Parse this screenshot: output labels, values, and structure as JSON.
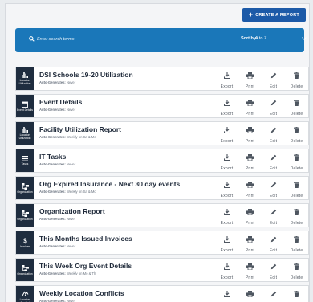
{
  "toolbar": {
    "create_label": "CREATE A REPORT"
  },
  "search": {
    "placeholder": "Enter search terms"
  },
  "sort": {
    "label": "Sort by",
    "value": "A to Z"
  },
  "actions": {
    "export": "Export",
    "print": "Print",
    "edit": "Edit",
    "delete": "Delete"
  },
  "colors": {
    "primary": "#1c5aa8",
    "search_bar": "#1a77b9",
    "type_tile": "#1f2d3f"
  },
  "reports": [
    {
      "title": "DSI Schools 19-20 Utilization",
      "auto_label": "Auto-Generates:",
      "auto_value": "Never",
      "type": "Location Utilization",
      "icon": "bar-chart-icon"
    },
    {
      "title": "Event Details",
      "auto_label": "Auto-Generates:",
      "auto_value": "Never",
      "type": "Event Details",
      "icon": "calendar-icon"
    },
    {
      "title": "Facility Utilization Report",
      "auto_label": "Auto-Generates:",
      "auto_value": "Weekly on Sa & Mo",
      "type": "Location Utilization",
      "icon": "bar-chart-icon"
    },
    {
      "title": "IT Tasks",
      "auto_label": "Auto-Generates:",
      "auto_value": "Never",
      "type": "Tasks",
      "icon": "list-icon"
    },
    {
      "title": "Org Expired Insurance - Next 30 day events",
      "auto_label": "Auto-Generates:",
      "auto_value": "Weekly on Sa & Mo",
      "type": "Organization",
      "icon": "org-chart-icon"
    },
    {
      "title": "Organization Report",
      "auto_label": "Auto-Generates:",
      "auto_value": "Never",
      "type": "Organization",
      "icon": "org-chart-icon"
    },
    {
      "title": "This Months Issued Invoices",
      "auto_label": "Auto-Generates:",
      "auto_value": "Never",
      "type": "Invoices",
      "icon": "dollar-icon"
    },
    {
      "title": "This Week Org Event Details",
      "auto_label": "Auto-Generates:",
      "auto_value": "Weekly on Mo & Th",
      "type": "Organization",
      "icon": "org-chart-icon"
    },
    {
      "title": "Weekly Location Conflicts",
      "auto_label": "Auto-Generates:",
      "auto_value": "Never",
      "type": "Location Conflict",
      "icon": "conflict-icon"
    }
  ]
}
